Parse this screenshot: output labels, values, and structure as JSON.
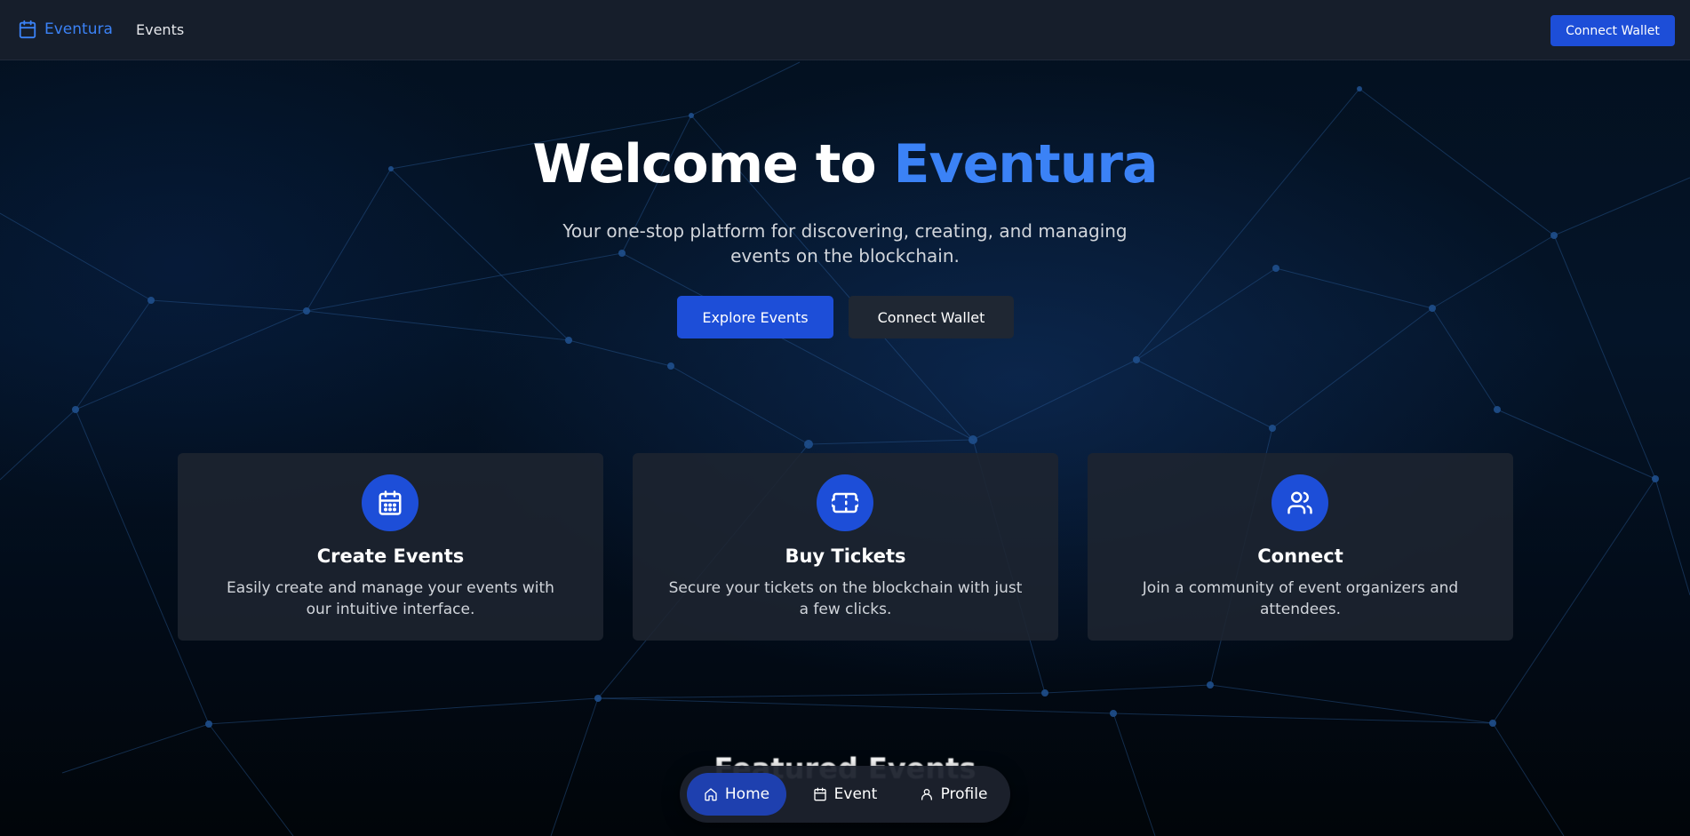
{
  "navbar": {
    "brand_name": "Eventura",
    "brand_icon": "calendar-icon",
    "events_link": "Events",
    "connect_wallet": "Connect Wallet"
  },
  "hero": {
    "title_prefix": "Welcome to",
    "title_accent": "Eventura",
    "subtitle": "Your one-stop platform for discovering, creating, and managing events on the blockchain.",
    "explore_button": "Explore Events",
    "connect_button": "Connect Wallet"
  },
  "features": [
    {
      "icon": "calendar-icon",
      "title": "Create Events",
      "description": "Easily create and manage your events with our intuitive interface."
    },
    {
      "icon": "ticket-icon",
      "title": "Buy Tickets",
      "description": "Secure your tickets on the blockchain with just a few clicks."
    },
    {
      "icon": "users-icon",
      "title": "Connect",
      "description": "Join a community of event organizers and attendees."
    }
  ],
  "featured_heading": "Featured Events",
  "bottom_nav": {
    "items": [
      {
        "label": "Home",
        "icon": "home-icon",
        "active": true
      },
      {
        "label": "Event",
        "icon": "calendar-icon",
        "active": false
      },
      {
        "label": "Profile",
        "icon": "user-icon",
        "active": false
      }
    ]
  },
  "colors": {
    "accent": "#3b82f6",
    "primary_button": "#1d4ed8",
    "navbar_bg": "#161e2b",
    "card_bg": "#1e2430"
  }
}
